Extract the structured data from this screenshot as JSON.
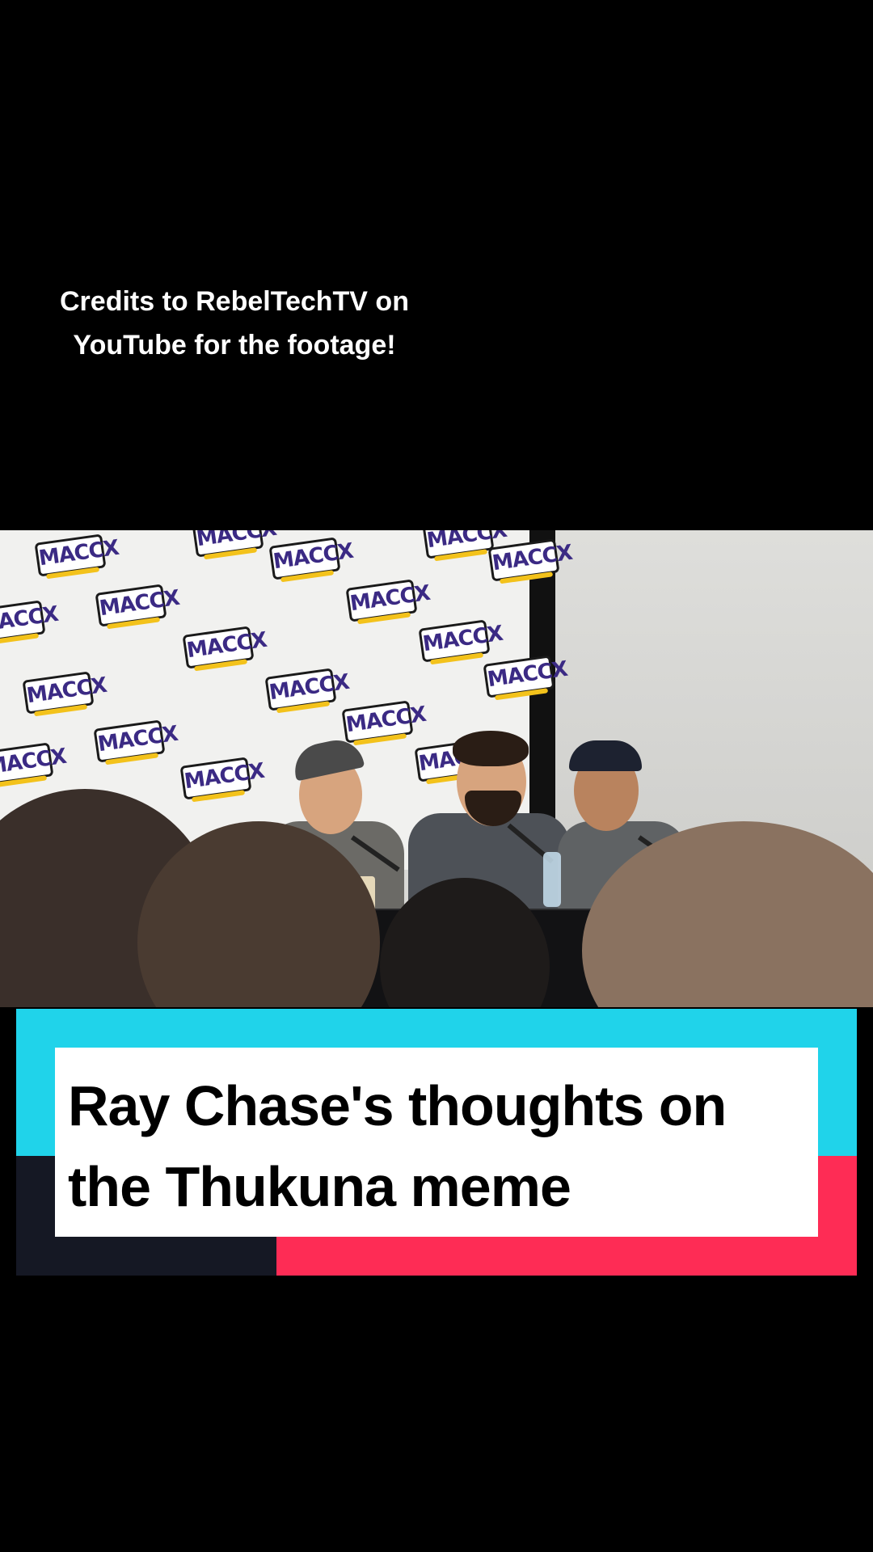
{
  "credits": {
    "line1": "Credits to RebelTechTV on",
    "line2": "YouTube for the footage!"
  },
  "video": {
    "banner_logo_text": "MACCX"
  },
  "caption": {
    "line1": "Ray Chase's thoughts on",
    "line2": "the Thukuna meme"
  },
  "colors": {
    "background": "#000000",
    "banner_cyan": "#20d3ea",
    "banner_red": "#fe2c55",
    "banner_dark": "#151824",
    "caption_box": "#ffffff"
  }
}
